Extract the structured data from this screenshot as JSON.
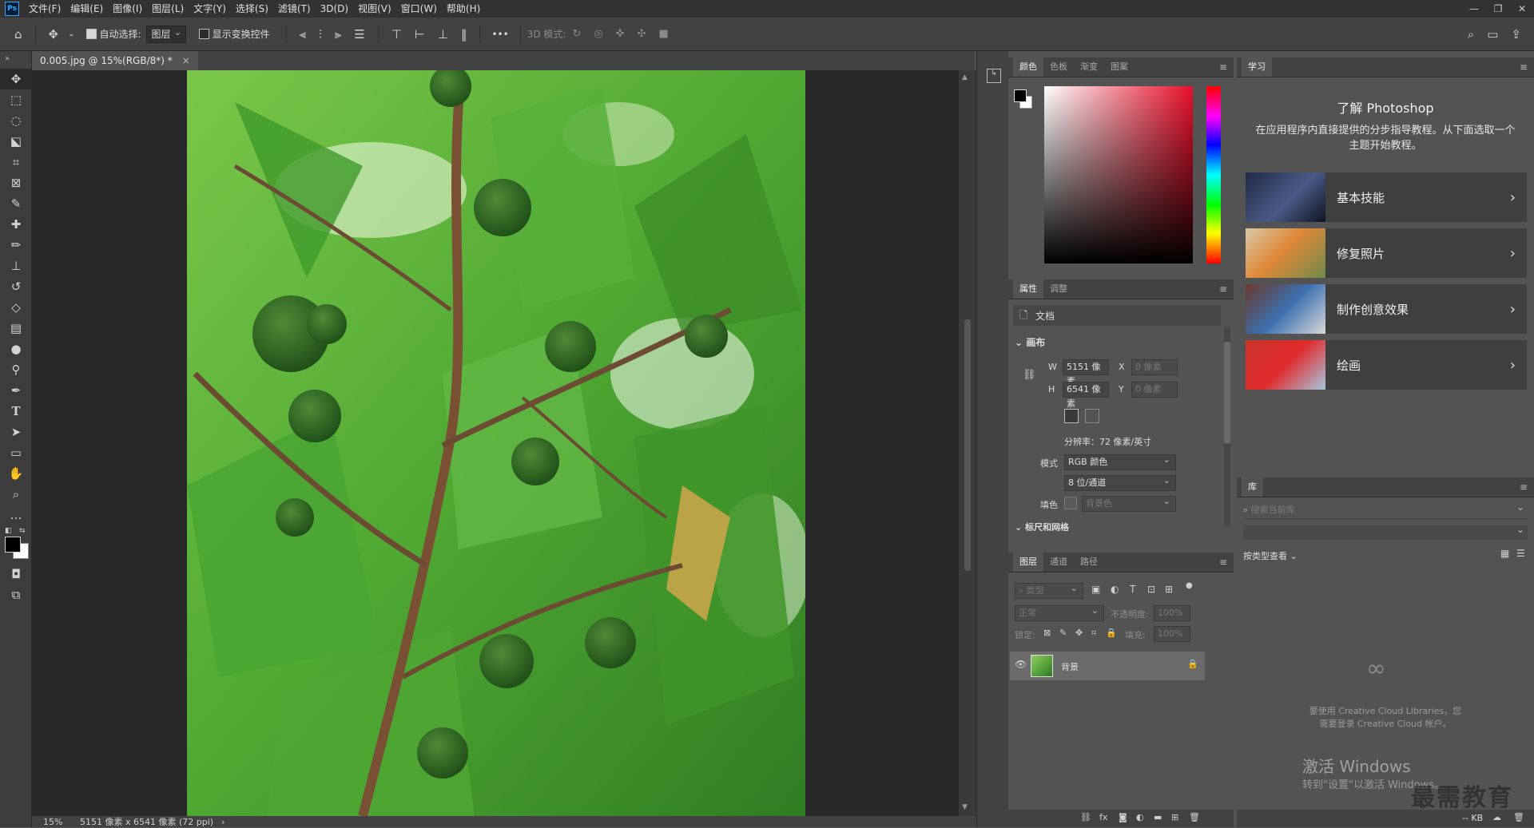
{
  "menubar": {
    "logo": "Ps",
    "items": [
      "文件(F)",
      "编辑(E)",
      "图像(I)",
      "图层(L)",
      "文字(Y)",
      "选择(S)",
      "滤镜(T)",
      "3D(D)",
      "视图(V)",
      "窗口(W)",
      "帮助(H)"
    ],
    "window_controls": [
      "—",
      "❐",
      "✕"
    ]
  },
  "optionsbar": {
    "auto_select_label": "自动选择:",
    "auto_select_value": "图层",
    "show_transform_label": "显示变换控件",
    "more": "•••",
    "mode3d_label": "3D 模式:"
  },
  "document": {
    "tab_title": "0.005.jpg @ 15%(RGB/8*) *",
    "tab_close": "×"
  },
  "statusbar": {
    "zoom": "15%",
    "info": "5151 像素 x 6541 像素 (72 ppi)",
    "arrow": "›"
  },
  "color_panel": {
    "tabs": [
      "颜色",
      "色板",
      "渐变",
      "图案"
    ]
  },
  "properties_panel": {
    "tabs": [
      "属性",
      "调整"
    ],
    "doc_label": "文档",
    "canvas_section": "画布",
    "w_label": "W",
    "w_value": "5151 像素",
    "h_label": "H",
    "h_value": "6541 像素",
    "x_label": "X",
    "x_placeholder": "0 像素",
    "y_label": "Y",
    "y_placeholder": "0 像素",
    "resolution": "分辨率：72 像素/英寸",
    "mode_label": "模式",
    "mode_value": "RGB 颜色",
    "depth_value": "8 位/通道",
    "fill_label": "填色",
    "fill_value": "背景色",
    "next_section": "标尺和网格"
  },
  "layers_panel": {
    "tabs": [
      "图层",
      "通道",
      "路径"
    ],
    "filter_placeholder": "类型",
    "blend_mode": "正常",
    "opacity_label": "不透明度:",
    "opacity_value": "100%",
    "lock_label": "锁定:",
    "fill_label": "填充:",
    "fill_value": "100%",
    "layer_name": "背景"
  },
  "learn_panel": {
    "tab": "学习",
    "title": "了解 Photoshop",
    "description": "在应用程序内直接提供的分步指导教程。从下面选取一个主题开始教程。",
    "cards": [
      {
        "label": "基本技能"
      },
      {
        "label": "修复照片"
      },
      {
        "label": "制作创意效果"
      },
      {
        "label": "绘画"
      }
    ]
  },
  "library_panel": {
    "tab": "库",
    "search_placeholder": "搜索当前库",
    "view_label": "按类型查看",
    "cc_message_line1": "要使用 Creative Cloud Libraries，您",
    "cc_message_line2": "需要登录 Creative Cloud 帐户。",
    "size": "-- KB"
  },
  "watermark": {
    "line1": "激活 Windows",
    "line2": "转到\"设置\"以激活 Windows。",
    "brand": "最需教育"
  }
}
